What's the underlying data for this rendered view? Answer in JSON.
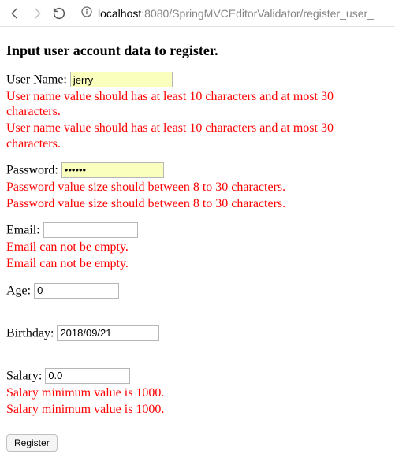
{
  "browser": {
    "url_host": "localhost",
    "url_rest": ":8080/SpringMVCEditorValidator/register_user_"
  },
  "page": {
    "title": "Input user account data to register.",
    "fields": {
      "username": {
        "label": "User Name:",
        "value": "jerry",
        "error1": "User name value should has at least 10 characters and at most 30 characters.",
        "error2": "User name value should has at least 10 characters and at most 30 characters."
      },
      "password": {
        "label": "Password:",
        "value": "••••••",
        "error1": "Password value size should between 8 to 30 characters.",
        "error2": "Password value size should between 8 to 30 characters."
      },
      "email": {
        "label": "Email:",
        "value": "",
        "error1": "Email can not be empty.",
        "error2": "Email can not be empty."
      },
      "age": {
        "label": "Age:",
        "value": "0"
      },
      "birthday": {
        "label": "Birthday:",
        "value": "2018/09/21"
      },
      "salary": {
        "label": "Salary:",
        "value": "0.0",
        "error1": "Salary minimum value is 1000.",
        "error2": "Salary minimum value is 1000."
      }
    },
    "submit_label": "Register"
  }
}
